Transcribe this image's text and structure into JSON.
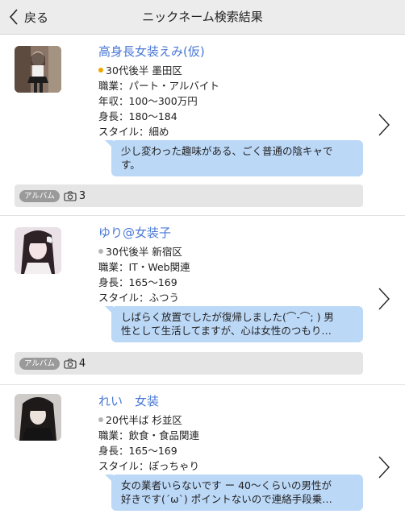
{
  "header": {
    "back_label": "戻る",
    "title": "ニックネーム検索結果"
  },
  "colors": {
    "link": "#4a78d6",
    "bubble": "#bcd8f7",
    "online_dot": "#f0a500",
    "offline_dot": "#b5b5b5"
  },
  "results": [
    {
      "name": "高身長女装えみ(仮)",
      "status": "online",
      "age_area": "30代後半 墨田区",
      "lines": [
        "職業：パート・アルバイト",
        "年収：100〜300万円",
        "身長：180〜184",
        "スタイル：細め"
      ],
      "message": [
        "少し変わった趣味がある、ごく普通の陰キャで",
        "す。"
      ],
      "album_label": "アルバム",
      "album_count": "3"
    },
    {
      "name": "ゆり@女装子",
      "status": "offline",
      "age_area": "30代後半 新宿区",
      "lines": [
        "職業：IT・Web関連",
        "身長：165〜169",
        "スタイル：ふつう"
      ],
      "message": [
        "しばらく放置でしたが復帰しました(⌒-⌒; ) 男",
        "性として生活してますが、心は女性のつもり…"
      ],
      "album_label": "アルバム",
      "album_count": "4"
    },
    {
      "name": "れい　女装",
      "status": "offline",
      "age_area": "20代半ば 杉並区",
      "lines": [
        "職業：飲食・食品関連",
        "身長：165〜169",
        "スタイル：ぽっちゃり"
      ],
      "message": [
        "女の業者いらないです ー 40〜くらいの男性が",
        "好きです(´ω`) ポイントないので連絡手段乗…"
      ]
    }
  ]
}
